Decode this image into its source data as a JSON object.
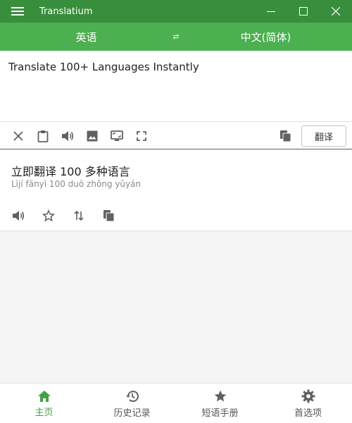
{
  "app": {
    "title": "Translatium"
  },
  "colors": {
    "titlebar": "#388e3c",
    "primary": "#4caf50",
    "active": "#43a047"
  },
  "languages": {
    "source": "英语",
    "target": "中文(简体)"
  },
  "input": {
    "text": "Translate 100+ Languages Instantly"
  },
  "input_toolbar": {
    "icons": [
      "clear-icon",
      "clipboard-icon",
      "speaker-icon",
      "image-icon",
      "screen-capture-icon",
      "fullscreen-icon",
      "copy-icon"
    ],
    "translate_label": "翻译"
  },
  "output": {
    "text": "立即翻译 100 多种语言",
    "pinyin": "Lìjí fānyì 100 duō zhǒng yǔyán",
    "icons": [
      "speaker-icon",
      "star-icon",
      "swap-vertical-icon",
      "copy-icon"
    ]
  },
  "bottom_nav": {
    "items": [
      {
        "label": "主页",
        "icon": "home-icon",
        "active": true
      },
      {
        "label": "历史记录",
        "icon": "history-icon",
        "active": false
      },
      {
        "label": "短语手册",
        "icon": "star-icon",
        "active": false
      },
      {
        "label": "首选项",
        "icon": "gear-icon",
        "active": false
      }
    ]
  }
}
